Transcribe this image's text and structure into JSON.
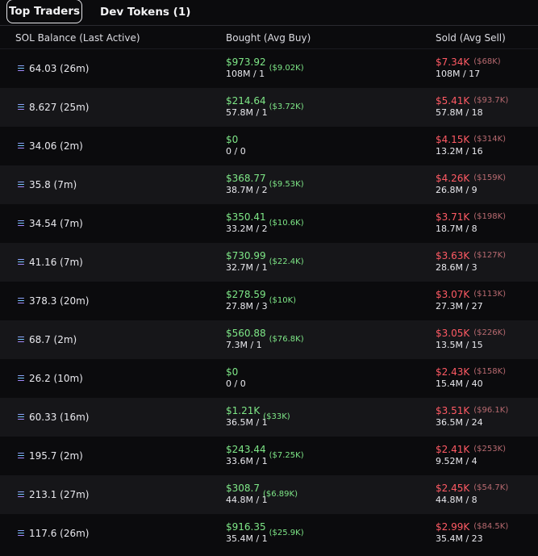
{
  "tabs": [
    {
      "label": "Top Traders"
    },
    {
      "label": "Dev Tokens (1)"
    }
  ],
  "columns": {
    "balance": "SOL Balance (Last Active)",
    "bought": "Bought (Avg Buy)",
    "sold": "Sold (Avg Sell)"
  },
  "rows": [
    {
      "balance": "64.03 (26m)",
      "bought": "$973.92",
      "bought_avg": "($9.02K)",
      "bought_sub": "108M / 1",
      "sold": "$7.34K",
      "sold_avg": "($68K)",
      "sold_sub": "108M / 17"
    },
    {
      "balance": "8.627 (25m)",
      "bought": "$214.64",
      "bought_avg": "($3.72K)",
      "bought_sub": "57.8M / 1",
      "sold": "$5.41K",
      "sold_avg": "($93.7K)",
      "sold_sub": "57.8M / 18"
    },
    {
      "balance": "34.06 (2m)",
      "bought": "$0",
      "bought_avg": "",
      "bought_sub": "0 / 0",
      "sold": "$4.15K",
      "sold_avg": "($314K)",
      "sold_sub": "13.2M / 16"
    },
    {
      "balance": "35.8 (7m)",
      "bought": "$368.77",
      "bought_avg": "($9.53K)",
      "bought_sub": "38.7M / 2",
      "sold": "$4.26K",
      "sold_avg": "($159K)",
      "sold_sub": "26.8M / 9"
    },
    {
      "balance": "34.54 (7m)",
      "bought": "$350.41",
      "bought_avg": "($10.6K)",
      "bought_sub": "33.2M / 2",
      "sold": "$3.71K",
      "sold_avg": "($198K)",
      "sold_sub": "18.7M / 8"
    },
    {
      "balance": "41.16 (7m)",
      "bought": "$730.99",
      "bought_avg": "($22.4K)",
      "bought_sub": "32.7M / 1",
      "sold": "$3.63K",
      "sold_avg": "($127K)",
      "sold_sub": "28.6M / 3"
    },
    {
      "balance": "378.3 (20m)",
      "bought": "$278.59",
      "bought_avg": "($10K)",
      "bought_sub": "27.8M / 3",
      "sold": "$3.07K",
      "sold_avg": "($113K)",
      "sold_sub": "27.3M / 27"
    },
    {
      "balance": "68.7 (2m)",
      "bought": "$560.88",
      "bought_avg": "($76.8K)",
      "bought_sub": "7.3M / 1",
      "sold": "$3.05K",
      "sold_avg": "($226K)",
      "sold_sub": "13.5M / 15"
    },
    {
      "balance": "26.2 (10m)",
      "bought": "$0",
      "bought_avg": "",
      "bought_sub": "0 / 0",
      "sold": "$2.43K",
      "sold_avg": "($158K)",
      "sold_sub": "15.4M / 40"
    },
    {
      "balance": "60.33 (16m)",
      "bought": "$1.21K",
      "bought_avg": "($33K)",
      "bought_sub": "36.5M / 1",
      "sold": "$3.51K",
      "sold_avg": "($96.1K)",
      "sold_sub": "36.5M / 24"
    },
    {
      "balance": "195.7 (2m)",
      "bought": "$243.44",
      "bought_avg": "($7.25K)",
      "bought_sub": "33.6M / 1",
      "sold": "$2.41K",
      "sold_avg": "($253K)",
      "sold_sub": "9.52M / 4"
    },
    {
      "balance": "213.1 (27m)",
      "bought": "$308.7",
      "bought_avg": "($6.89K)",
      "bought_sub": "44.8M / 1",
      "sold": "$2.45K",
      "sold_avg": "($54.7K)",
      "sold_sub": "44.8M / 8"
    },
    {
      "balance": "117.6 (26m)",
      "bought": "$916.35",
      "bought_avg": "($25.9K)",
      "bought_sub": "35.4M / 1",
      "sold": "$2.99K",
      "sold_avg": "($84.5K)",
      "sold_sub": "35.4M / 23"
    }
  ],
  "colors": {
    "buy": "#7ee787",
    "sell": "#ff5a64",
    "row_alt": "#161619",
    "background": "#0b0b0d"
  },
  "icons": {
    "balance": "solana-icon"
  }
}
